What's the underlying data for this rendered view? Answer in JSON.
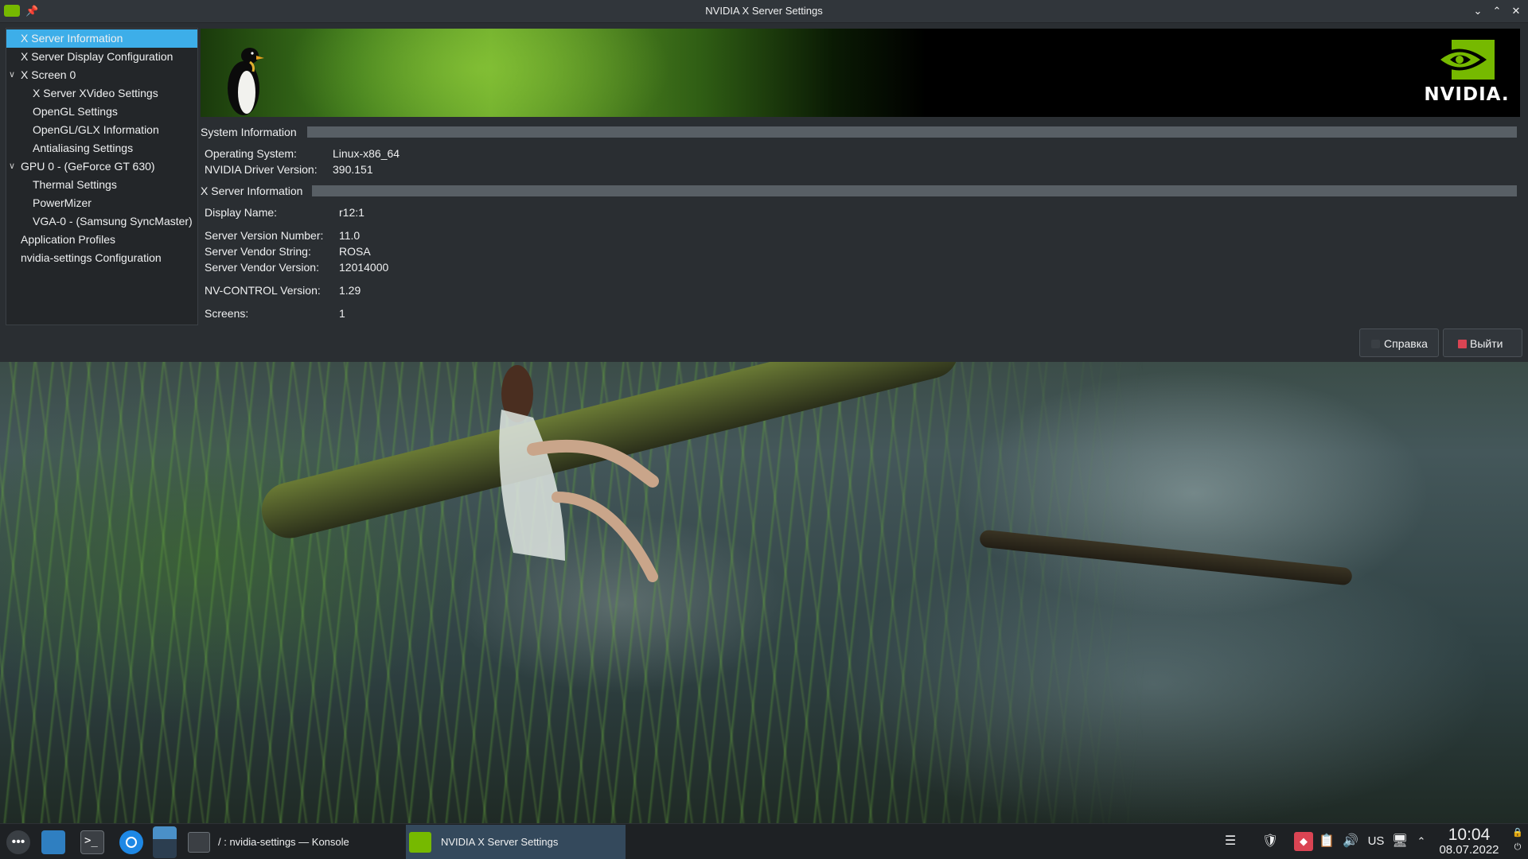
{
  "window": {
    "title": "NVIDIA X Server Settings",
    "buttons": {
      "minimize": "⌄",
      "maximize": "⌃",
      "close": "✕"
    }
  },
  "sidebar": {
    "items": [
      {
        "label": "X Server Information",
        "selected": true,
        "level": 0
      },
      {
        "label": "X Server Display Configuration",
        "level": 0
      },
      {
        "label": "X Screen 0",
        "level": 0,
        "expanded": true
      },
      {
        "label": "X Server XVideo Settings",
        "level": 1
      },
      {
        "label": "OpenGL Settings",
        "level": 1
      },
      {
        "label": "OpenGL/GLX Information",
        "level": 1
      },
      {
        "label": "Antialiasing Settings",
        "level": 1
      },
      {
        "label": "GPU 0 - (GeForce GT 630)",
        "level": 0,
        "expanded": true
      },
      {
        "label": "Thermal Settings",
        "level": 1
      },
      {
        "label": "PowerMizer",
        "level": 1
      },
      {
        "label": "VGA-0 - (Samsung SyncMaster)",
        "level": 1
      },
      {
        "label": "Application Profiles",
        "level": 0
      },
      {
        "label": "nvidia-settings Configuration",
        "level": 0
      }
    ]
  },
  "banner": {
    "logo_text": "NVIDIA."
  },
  "system_info": {
    "heading": "System Information",
    "os_key": "Operating System:",
    "os_val": "Linux-x86_64",
    "driver_key": "NVIDIA Driver Version:",
    "driver_val": "390.151"
  },
  "xserver_info": {
    "heading": "X Server Information",
    "display_key": "Display Name:",
    "display_val": "r12:1",
    "version_key": "Server Version Number:",
    "version_val": "11.0",
    "vendor_key": "Server Vendor String:",
    "vendor_val": "ROSA",
    "vendor_ver_key": "Server Vendor Version:",
    "vendor_ver_val": "12014000",
    "nvcontrol_key": "NV-CONTROL Version:",
    "nvcontrol_val": "1.29",
    "screens_key": "Screens:",
    "screens_val": "1"
  },
  "buttons": {
    "help": "Справка",
    "quit": "Выйти"
  },
  "taskbar": {
    "tasks": [
      {
        "label": "/ : nvidia-settings — Konsole"
      },
      {
        "label": "NVIDIA X Server Settings",
        "active": true
      }
    ],
    "keyboard_layout": "US",
    "time": "10:04",
    "date": "08.07.2022"
  },
  "colors": {
    "accent": "#3daee9",
    "nvidia_green": "#76b900",
    "quit_icon": "#da4453"
  }
}
